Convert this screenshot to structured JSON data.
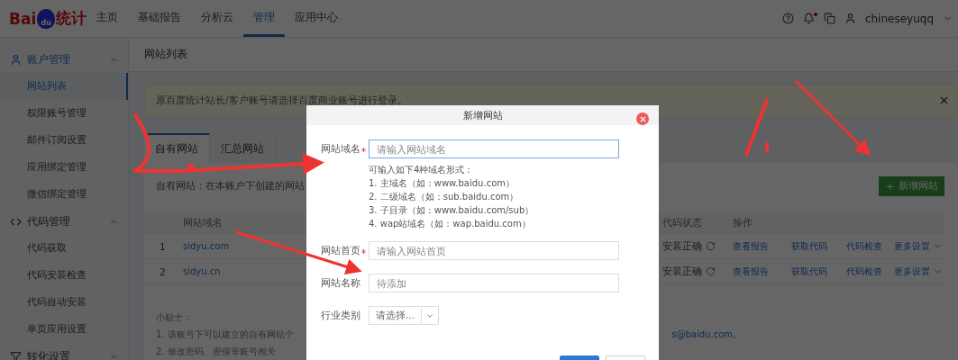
{
  "logo": {
    "text_left": "Bai",
    "paw_text": "du",
    "text_right": "统计"
  },
  "nav": [
    {
      "label": "主页",
      "selected": false
    },
    {
      "label": "基础报告",
      "selected": false
    },
    {
      "label": "分析云",
      "selected": false
    },
    {
      "label": "管理",
      "selected": true
    },
    {
      "label": "应用中心",
      "selected": false
    }
  ],
  "user": {
    "name": "chineseyuqq",
    "has_notification": true
  },
  "sidebar": [
    {
      "title": "账户管理",
      "expanded": true,
      "items": [
        {
          "label": "网站列表",
          "selected": true
        },
        {
          "label": "权限账号管理",
          "selected": false
        },
        {
          "label": "邮件订阅设置",
          "selected": false
        },
        {
          "label": "应用绑定管理",
          "selected": false
        },
        {
          "label": "微信绑定管理",
          "selected": false
        }
      ]
    },
    {
      "title": "代码管理",
      "expanded": true,
      "items": [
        {
          "label": "代码获取",
          "selected": false
        },
        {
          "label": "代码安装检查",
          "selected": false
        },
        {
          "label": "代码自动安装",
          "selected": false
        },
        {
          "label": "单页应用设置",
          "selected": false
        }
      ]
    },
    {
      "title": "转化设置",
      "expanded": true
    }
  ],
  "page_title": "网站列表",
  "notice": {
    "text": "原百度统计站长/客户账号请选择百度商业账号进行登录。"
  },
  "tabs": [
    {
      "label": "自有网站",
      "selected": true
    },
    {
      "label": "汇总网站",
      "selected": false
    }
  ],
  "info_text": "自有网站：在本账户下创建的网站",
  "add_button": "新增网站",
  "table": {
    "columns": [
      {
        "label": "网站域名"
      },
      {
        "label": "代码状态"
      },
      {
        "label": "操作"
      }
    ],
    "rows": [
      {
        "index": "1",
        "domain": "sidyu.com",
        "status": "安装正确",
        "actions": [
          "查看报告",
          "获取代码",
          "代码检查",
          "更多设置"
        ]
      },
      {
        "index": "2",
        "domain": "sidyu.cn",
        "status": "安装正确",
        "actions": [
          "查看报告",
          "获取代码",
          "代码检查",
          "更多设置"
        ]
      }
    ]
  },
  "tips": {
    "title": "小贴士：",
    "lines": [
      "1. 该账号下可以建立的自有网站个",
      "2. 修改密码、密保等账号相关"
    ],
    "email_fragment": "s@baidu.com。"
  },
  "dialog": {
    "title": "新增网站",
    "fields": [
      {
        "kind": "input",
        "label": "网站域名",
        "required": true,
        "focused": true,
        "placeholder": "请输入网站域名",
        "hints": [
          "可输入如下4种域名形式：",
          "1. 主域名（如：www.baidu.com）",
          "2. 二级域名（如：sub.baidu.com）",
          "3. 子目录（如：www.baidu.com/sub）",
          "4. wap站域名（如：wap.baidu.com）"
        ]
      },
      {
        "kind": "input",
        "label": "网站首页",
        "required": true,
        "focused": false,
        "placeholder": "请输入网站首页"
      },
      {
        "kind": "input",
        "label": "网站名称",
        "required": false,
        "focused": false,
        "placeholder": "待添加"
      },
      {
        "kind": "select",
        "label": "行业类别",
        "required": false,
        "placeholder": "请选择..."
      }
    ]
  }
}
